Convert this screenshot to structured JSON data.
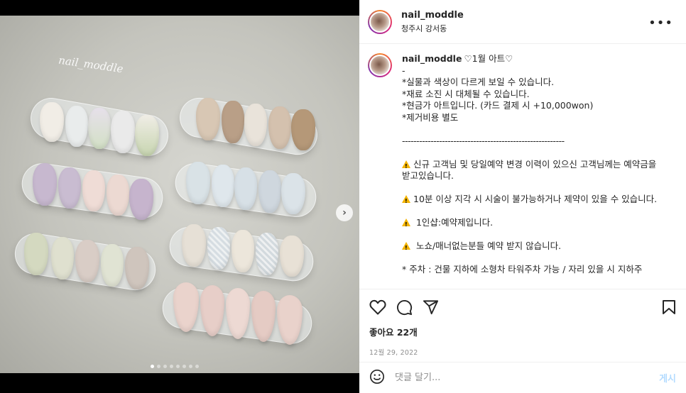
{
  "post": {
    "watermark": "nail_moddle",
    "slide_count": 8,
    "active_slide": 0
  },
  "header": {
    "username": "nail_moddle",
    "location": "청주시 강서동",
    "more_icon": "more-horizontal-icon"
  },
  "caption": {
    "username": "nail_moddle",
    "lines": [
      "♡1월 아트♡",
      "-",
      "*실물과 색상이 다르게 보일 수 있습니다.",
      "*재료 소진 시 대체될 수 있습니다.",
      "*현금가 아트입니다. (카드 결제 시 +10,000won)",
      "*제거비용 별도",
      "",
      "---------------------------------------------------------",
      ""
    ],
    "notices": [
      "신규 고객님 및 당일예약 변경 이력이 있으신 고객님께는 예약금을 받고있습니다.",
      "10분 이상 지각 시 시술이 불가능하거나 제약이 있을 수 있습니다.",
      " 1인샵:예약제입니다.",
      " 노쇼/매너없는분들 예약 받지 않습니다."
    ],
    "footer": "* 주차 : 건물 지하에 소형차 타워주차 가능 / 자리 있을 시 지하주"
  },
  "actions": {
    "likes": "좋아요 22개",
    "date": "12월 29, 2022"
  },
  "comment": {
    "placeholder": "댓글 달기...",
    "post_label": "게시"
  },
  "colors": {
    "link": "#b3dbff",
    "muted": "#8e8e8e",
    "text": "#262626",
    "warning": "#f4b400"
  }
}
